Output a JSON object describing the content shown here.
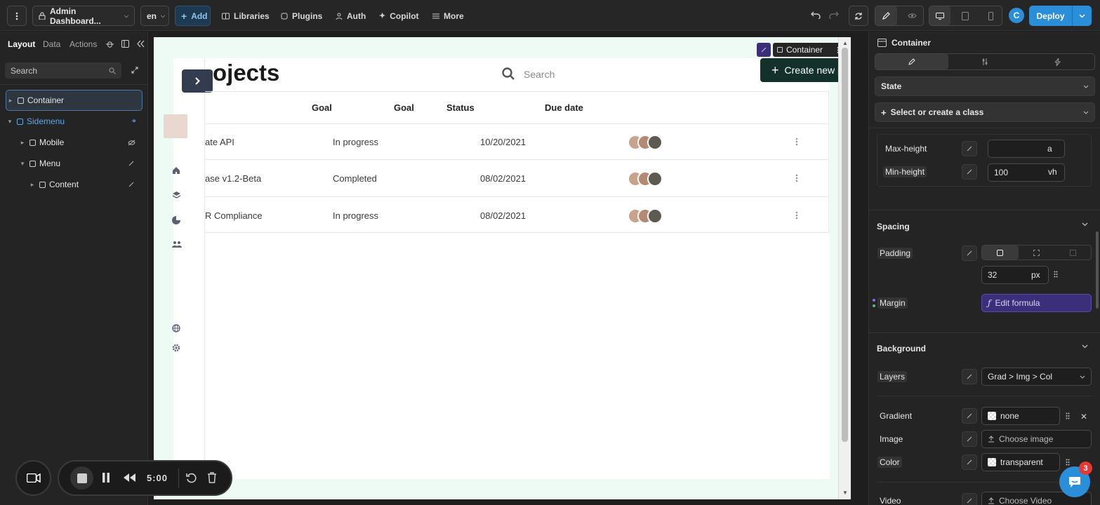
{
  "topbar": {
    "project": "Admin Dashboard...",
    "lang": "en",
    "add": "Add",
    "nav": [
      "Libraries",
      "Plugins",
      "Auth",
      "Copilot",
      "More"
    ],
    "avatar_initial": "C",
    "deploy": "Deploy"
  },
  "left": {
    "tabs": [
      "Layout",
      "Data",
      "Actions"
    ],
    "search_placeholder": "Search",
    "tree": [
      "Container",
      "Sidemenu",
      "Mobile",
      "Menu",
      "Content"
    ]
  },
  "canvas": {
    "page_title": "ojects",
    "search_placeholder": "Search",
    "create_button": "Create new pr",
    "selection_label": "Container",
    "headers": [
      "Goal",
      "Goal",
      "Status",
      "Due date"
    ],
    "rows": [
      {
        "name": "ate API",
        "status": "In progress",
        "date": "10/20/2021"
      },
      {
        "name": "ase v1.2-Beta",
        "status": "Completed",
        "date": "08/02/2021"
      },
      {
        "name": "R Compliance",
        "status": "In progress",
        "date": "08/02/2021"
      }
    ]
  },
  "recorder": {
    "time": "5:00"
  },
  "right": {
    "title": "Container",
    "state": "State",
    "class_select": "Select or create a class",
    "max_height_label": "Max-height",
    "max_height_unit": "a",
    "min_height_label": "Min-height",
    "min_height_value": "100",
    "min_height_unit": "vh",
    "spacing": "Spacing",
    "padding_label": "Padding",
    "padding_value": "32",
    "padding_unit": "px",
    "margin_label": "Margin",
    "edit_formula": "Edit formula",
    "background": "Background",
    "layers_label": "Layers",
    "layers_value": "Grad > Img > Col",
    "gradient_label": "Gradient",
    "gradient_value": "none",
    "image_label": "Image",
    "image_value": "Choose image",
    "color_label": "Color",
    "color_value": "transparent",
    "video_label": "Video",
    "video_value": "Choose Video",
    "badge_count": "3"
  },
  "colors": {
    "accent": "#2a8ed8",
    "dark_green": "#13302a",
    "formula_purple": "#3b2f7a"
  }
}
